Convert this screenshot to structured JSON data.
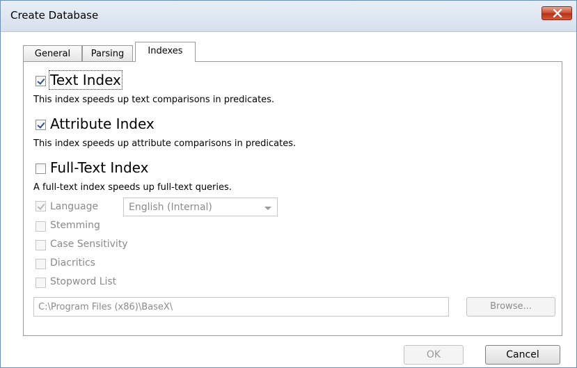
{
  "window": {
    "title": "Create Database"
  },
  "tabs": [
    {
      "label": "General",
      "active": false
    },
    {
      "label": "Parsing",
      "active": false
    },
    {
      "label": "Indexes",
      "active": true
    }
  ],
  "indexes": {
    "text_index": {
      "label": "Text Index",
      "checked": true,
      "description": "This index speeds up text comparisons in predicates."
    },
    "attribute_index": {
      "label": "Attribute Index",
      "checked": true,
      "description": "This index speeds up attribute comparisons in predicates."
    },
    "fulltext_index": {
      "label": "Full-Text Index",
      "checked": false,
      "description": "A full-text index speeds up full-text queries."
    }
  },
  "fulltext_options": {
    "language": {
      "label": "Language",
      "checked": true,
      "enabled": false,
      "selected": "English (Internal)"
    },
    "stemming": {
      "label": "Stemming",
      "checked": false,
      "enabled": false
    },
    "case_sensitivity": {
      "label": "Case Sensitivity",
      "checked": false,
      "enabled": false
    },
    "diacritics": {
      "label": "Diacritics",
      "checked": false,
      "enabled": false
    },
    "stopword_list": {
      "label": "Stopword List",
      "checked": false,
      "enabled": false
    },
    "path": "C:\\Program Files (x86)\\BaseX\\",
    "browse_label": "Browse..."
  },
  "buttons": {
    "ok_label": "OK",
    "cancel_label": "Cancel"
  },
  "colors": {
    "close_button": "#c9462e",
    "check_mark": "#2b4f8c",
    "disabled_text": "#8a8a8a"
  }
}
